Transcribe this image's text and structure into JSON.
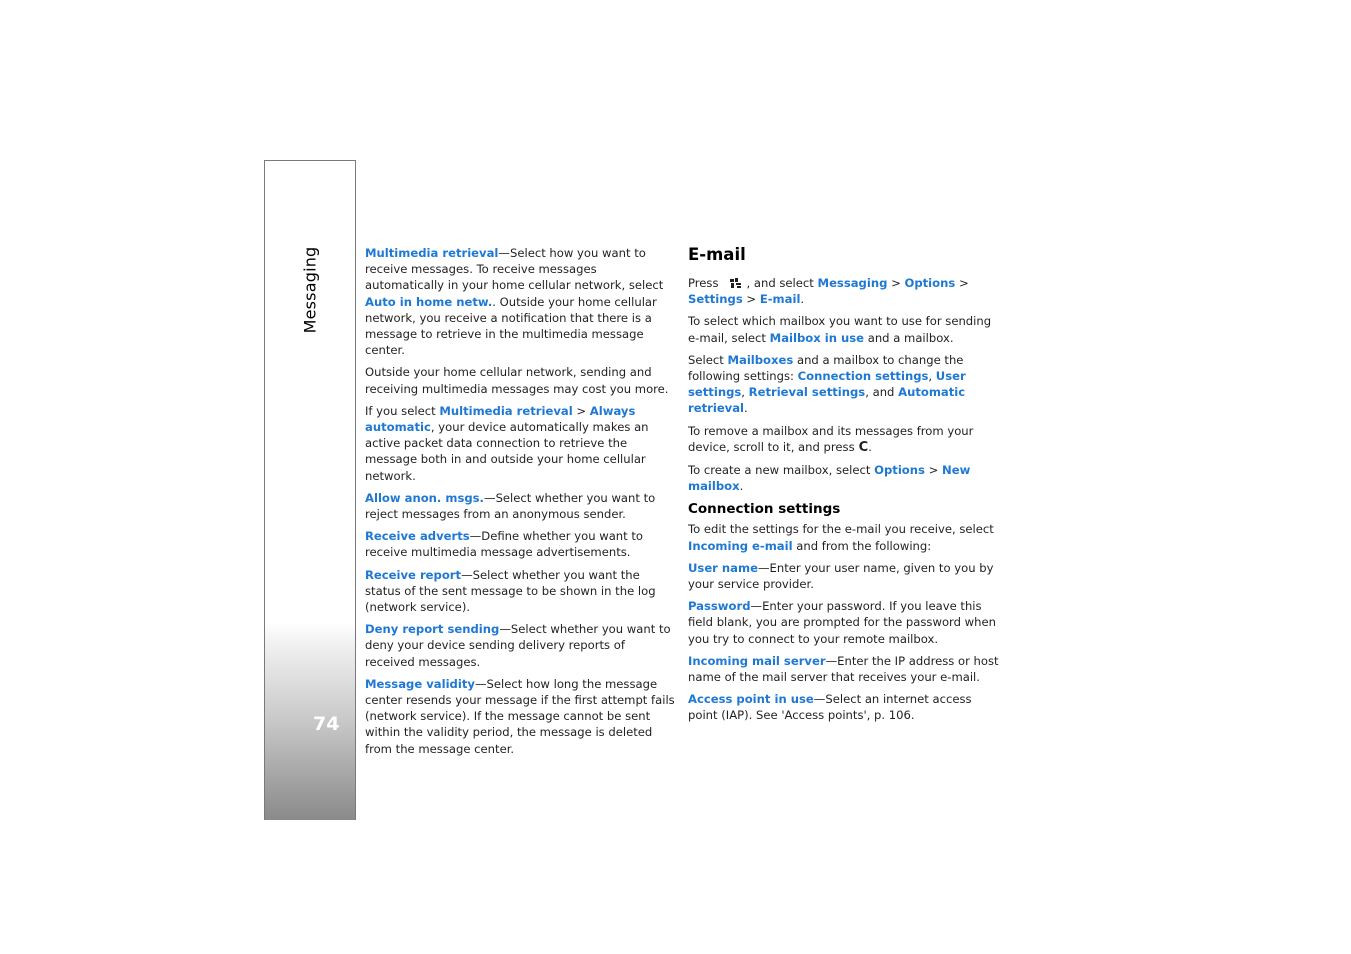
{
  "sidebar": {
    "section_label": "Messaging",
    "page_number": "74"
  },
  "left_column": {
    "p1": {
      "link1": "Multimedia retrieval",
      "text1": "—Select how you want to receive messages. To receive messages automatically in your home cellular network, select ",
      "link2": "Auto in home netw.",
      "text2": ". Outside your home cellular network, you receive a notification that there is a message to retrieve in the multimedia message center."
    },
    "p2": {
      "text": "Outside your home cellular network, sending and receiving multimedia messages may cost you more."
    },
    "p3": {
      "text1": "If you select ",
      "link1": "Multimedia retrieval",
      "sep": " > ",
      "link2": "Always automatic",
      "text2": ", your device automatically makes an active packet data connection to retrieve the message both in and outside your home cellular network."
    },
    "p4": {
      "link": "Allow anon. msgs.",
      "text": "—Select whether you want to reject messages from an anonymous sender."
    },
    "p5": {
      "link": "Receive adverts",
      "text": "—Define whether you want to receive multimedia message advertisements."
    },
    "p6": {
      "link": "Receive report",
      "text": "—Select whether you want the status of the sent message to be shown in the log (network service)."
    },
    "p7": {
      "link": "Deny report sending",
      "text": "—Select whether you want to deny your device sending delivery reports of received messages."
    },
    "p8": {
      "link": "Message validity",
      "text": "—Select how long the message center resends your message if the first attempt fails (network service). If the message cannot be sent within the validity period, the message is deleted from the message center."
    }
  },
  "right_column": {
    "heading": "E-mail",
    "p1": {
      "text1": "Press",
      "icon": "menu-key-icon",
      "text2": ", and select ",
      "link1": "Messaging",
      "sep1": " > ",
      "link2": "Options",
      "sep2": " > ",
      "link3": "Settings",
      "sep3": " > ",
      "link4": "E-mail",
      "text3": "."
    },
    "p2": {
      "text1": "To select which mailbox you want to use for sending e-mail, select ",
      "link": "Mailbox in use",
      "text2": " and a mailbox."
    },
    "p3": {
      "text1": "Select ",
      "link1": "Mailboxes",
      "text2": " and a mailbox to change the following settings: ",
      "link2": "Connection settings",
      "sep1": ", ",
      "link3": "User settings",
      "sep2": ", ",
      "link4": "Retrieval settings",
      "text3": ", and ",
      "link5": "Automatic retrieval",
      "text4": "."
    },
    "p4": {
      "text1": "To remove a mailbox and its messages from your device, scroll to it, and press",
      "icon": "C",
      "text2": "."
    },
    "p5": {
      "text1": "To create a new mailbox, select ",
      "link1": "Options",
      "sep": " > ",
      "link2": "New mailbox",
      "text2": "."
    },
    "subheading": "Connection settings",
    "p6": {
      "text1": "To edit the settings for the e-mail you receive, select ",
      "link": "Incoming e-mail",
      "text2": " and from the following:"
    },
    "p7": {
      "link": "User name",
      "text": "—Enter your user name, given to you by your service provider."
    },
    "p8": {
      "link": "Password",
      "text": "—Enter your password. If you leave this field blank, you are prompted for the password when you try to connect to your remote mailbox."
    },
    "p9": {
      "link": "Incoming mail server",
      "text": "—Enter the IP address or host name of the mail server that receives your e-mail."
    },
    "p10": {
      "link": "Access point in use",
      "text": "—Select an internet access point (IAP). See 'Access points', p. 106."
    }
  },
  "colors": {
    "link": "#1f79d4",
    "text": "#231f20"
  }
}
